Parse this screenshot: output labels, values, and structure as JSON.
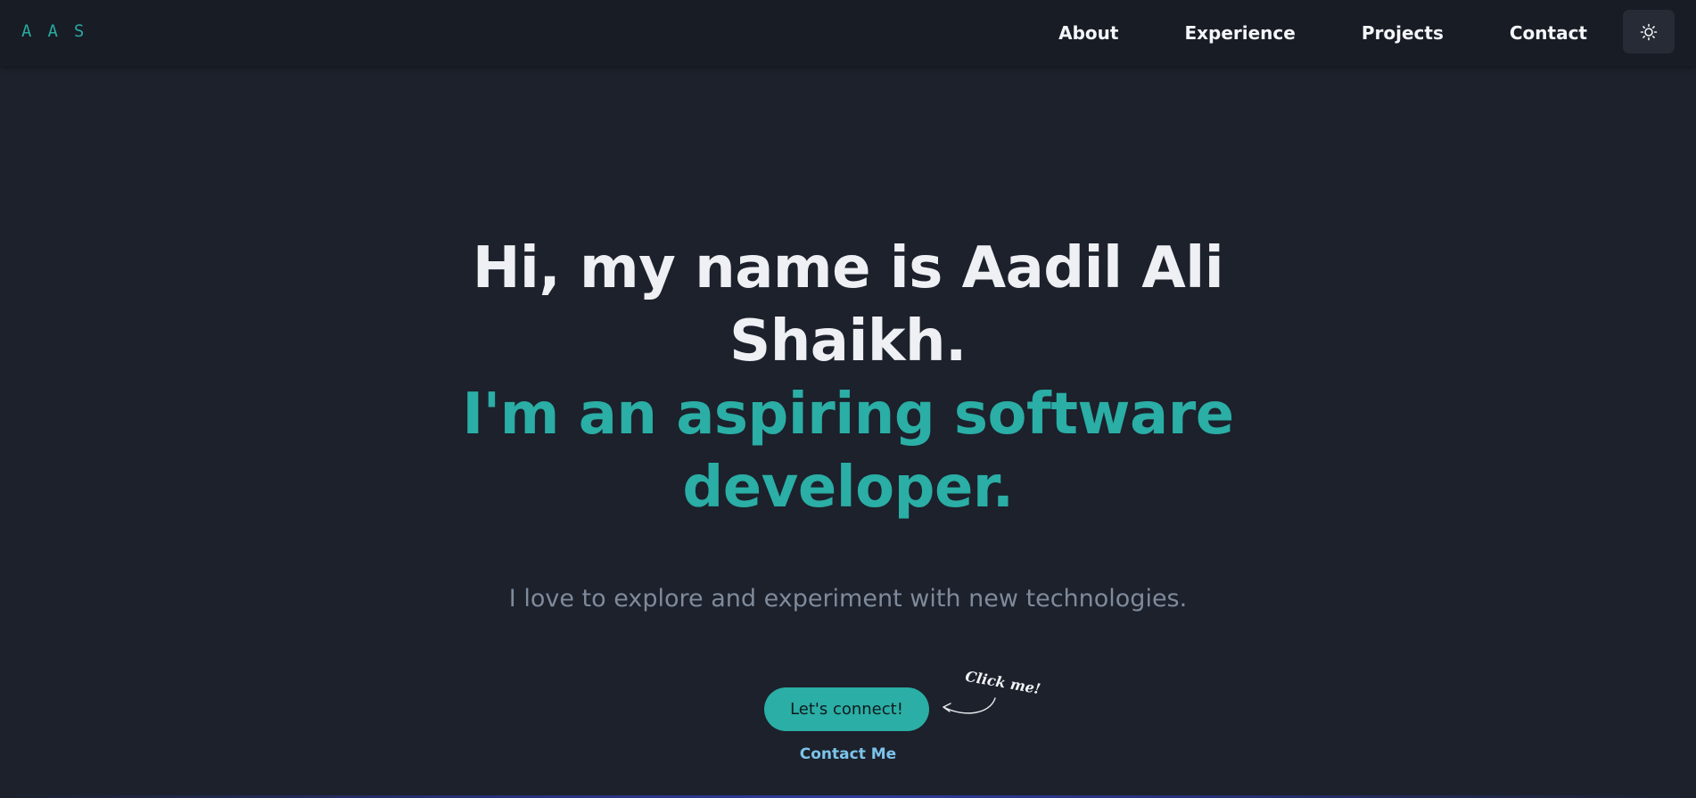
{
  "logo": "AAS",
  "nav": {
    "items": [
      {
        "label": "About"
      },
      {
        "label": "Experience"
      },
      {
        "label": "Projects"
      },
      {
        "label": "Contact"
      }
    ],
    "theme_toggle_icon": "sun-icon"
  },
  "hero": {
    "line1": "Hi, my name is Aadil Ali Shaikh.",
    "line2": "I'm an aspiring software developer.",
    "tagline": "I love to explore and experiment with new technologies.",
    "cta_label": "Let's connect!",
    "click_me": "Click me!",
    "contact_link": "Contact Me"
  },
  "colors": {
    "background": "#1c212c",
    "navbar": "#181c25",
    "accent": "#2aaea5",
    "link": "#7cc3ea",
    "muted_text": "#7f8a9b"
  }
}
